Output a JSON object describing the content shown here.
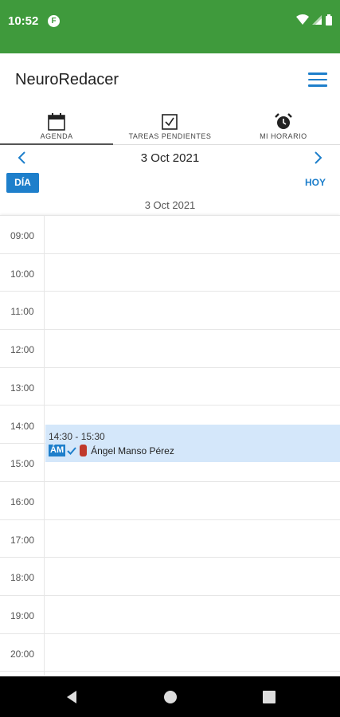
{
  "status_bar": {
    "time": "10:52",
    "app_icon": "F"
  },
  "app_bar": {
    "title": "NeuroRedacer"
  },
  "tabs": [
    {
      "label": "AGENDA",
      "icon": "calendar-icon",
      "active": true
    },
    {
      "label": "TAREAS PENDIENTES",
      "icon": "checkbox-icon",
      "active": false
    },
    {
      "label": "MI HORARIO",
      "icon": "alarm-clock-icon",
      "active": false
    }
  ],
  "date_nav": {
    "title": "3 Oct 2021"
  },
  "view_button": {
    "label": "DÍA"
  },
  "today_button": {
    "label": "HOY"
  },
  "day_header": "3 Oct 2021",
  "hours": [
    "09:00",
    "10:00",
    "11:00",
    "12:00",
    "13:00",
    "14:00",
    "15:00",
    "16:00",
    "17:00",
    "18:00",
    "19:00",
    "20:00"
  ],
  "event": {
    "time": "14:30 - 15:30",
    "initials": "ÁM",
    "name": "Ángel Manso Pérez"
  },
  "colors": {
    "status_bar": "#3f9a3c",
    "accent": "#1e7fcb",
    "event_bg": "#d4e7fa",
    "badge": "#c0392b"
  }
}
